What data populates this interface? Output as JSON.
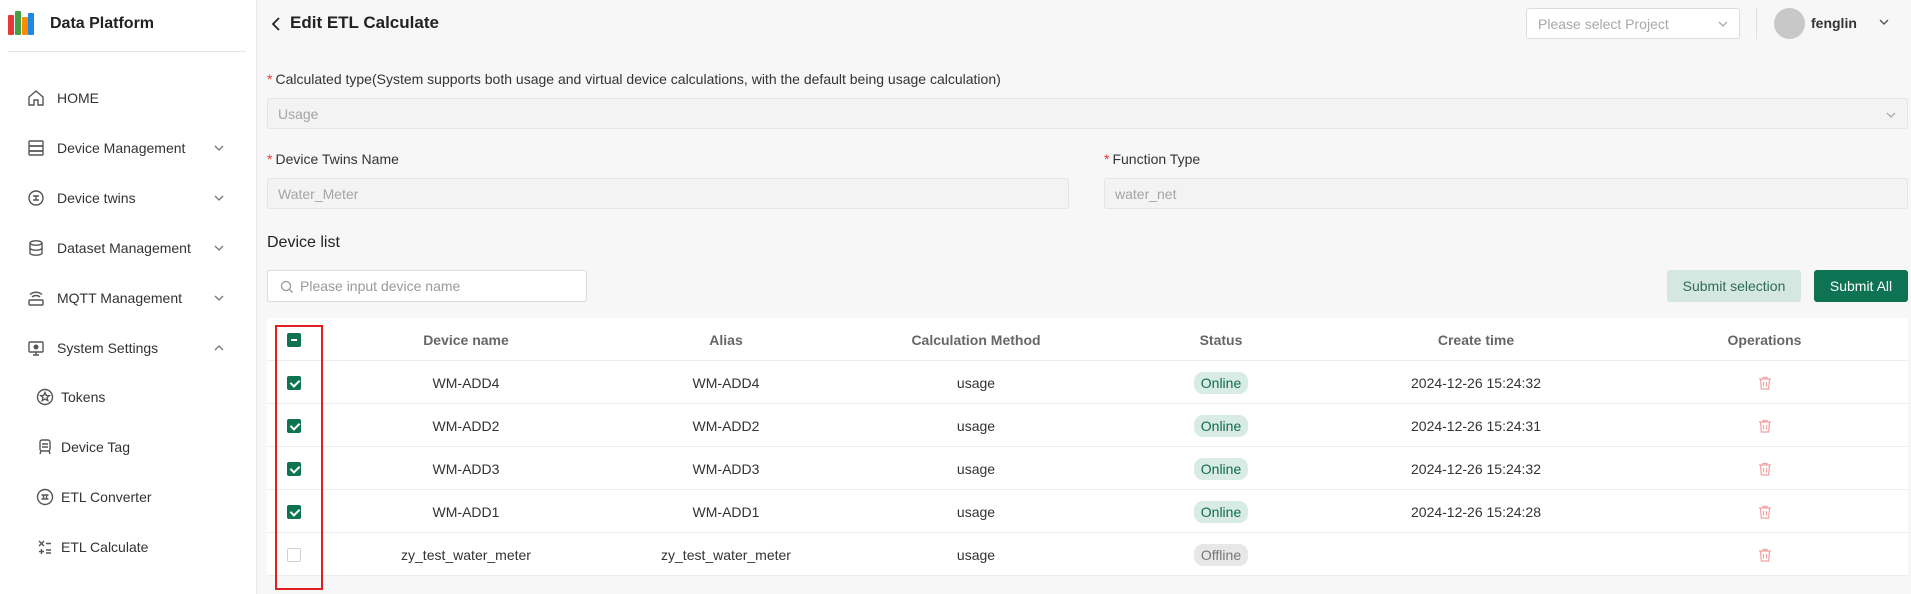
{
  "brand": {
    "name": "Data Platform"
  },
  "sidebar": {
    "items": [
      {
        "label": "HOME",
        "icon": "home-icon",
        "chevron": ""
      },
      {
        "label": "Device Management",
        "icon": "server-icon",
        "chevron": "down"
      },
      {
        "label": "Device twins",
        "icon": "twin-icon",
        "chevron": "down"
      },
      {
        "label": "Dataset Management",
        "icon": "database-icon",
        "chevron": "down"
      },
      {
        "label": "MQTT Management",
        "icon": "router-icon",
        "chevron": "down"
      },
      {
        "label": "System Settings",
        "icon": "monitor-icon",
        "chevron": "up"
      }
    ],
    "sub_items": [
      {
        "label": "Tokens",
        "icon": "star-icon"
      },
      {
        "label": "Device Tag",
        "icon": "tag-icon"
      },
      {
        "label": "ETL Converter",
        "icon": "converter-icon"
      },
      {
        "label": "ETL Calculate",
        "icon": "calculate-icon"
      }
    ]
  },
  "header": {
    "title": "Edit ETL Calculate",
    "project_placeholder": "Please select Project",
    "username": "fenglin"
  },
  "form": {
    "calc_type_label": "Calculated type(System supports both usage and virtual device calculations, with the default being usage calculation)",
    "calc_type_value": "Usage",
    "twins_label": "Device Twins Name",
    "twins_value": "Water_Meter",
    "function_label": "Function Type",
    "function_value": "water_net",
    "required_mark": "*"
  },
  "device_list": {
    "title": "Device list",
    "search_placeholder": "Please input device name",
    "submit_selection": "Submit selection",
    "submit_all": "Submit All",
    "columns": [
      "Device name",
      "Alias",
      "Calculation Method",
      "Status",
      "Create time",
      "Operations"
    ],
    "rows": [
      {
        "checked": true,
        "name": "WM-ADD4",
        "alias": "WM-ADD4",
        "method": "usage",
        "status": "Online",
        "time": "2024-12-26 15:24:32"
      },
      {
        "checked": true,
        "name": "WM-ADD2",
        "alias": "WM-ADD2",
        "method": "usage",
        "status": "Online",
        "time": "2024-12-26 15:24:31"
      },
      {
        "checked": true,
        "name": "WM-ADD3",
        "alias": "WM-ADD3",
        "method": "usage",
        "status": "Online",
        "time": "2024-12-26 15:24:32"
      },
      {
        "checked": true,
        "name": "WM-ADD1",
        "alias": "WM-ADD1",
        "method": "usage",
        "status": "Online",
        "time": "2024-12-26 15:24:28"
      },
      {
        "checked": false,
        "name": "zy_test_water_meter",
        "alias": "zy_test_water_meter",
        "method": "usage",
        "status": "Offline",
        "time": ""
      }
    ]
  },
  "colors": {
    "primary": "#0e7353",
    "highlight": "#e02020",
    "danger_icon": "#f2a0a0"
  }
}
